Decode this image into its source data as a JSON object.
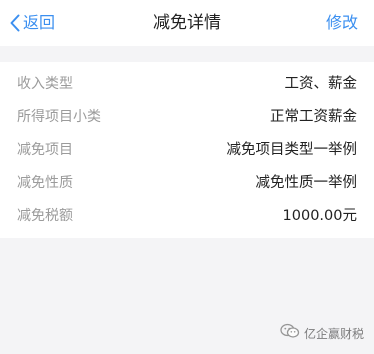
{
  "nav": {
    "back_label": "返回",
    "title": "减免详情",
    "edit_label": "修改"
  },
  "details": {
    "rows": [
      {
        "label": "收入类型",
        "value": "工资、薪金"
      },
      {
        "label": "所得项目小类",
        "value": "正常工资薪金"
      },
      {
        "label": "减免项目",
        "value": "减免项目类型一举例"
      },
      {
        "label": "减免性质",
        "value": "减免性质一举例"
      },
      {
        "label": "减免税额",
        "value": "1000.00元"
      }
    ]
  },
  "watermark": {
    "text": "亿企赢财税",
    "icon": "wechat-official-account-icon"
  },
  "colors": {
    "accent": "#3b8ff0",
    "label": "#9b9b9b",
    "value": "#222222",
    "background": "#f4f4f6"
  }
}
